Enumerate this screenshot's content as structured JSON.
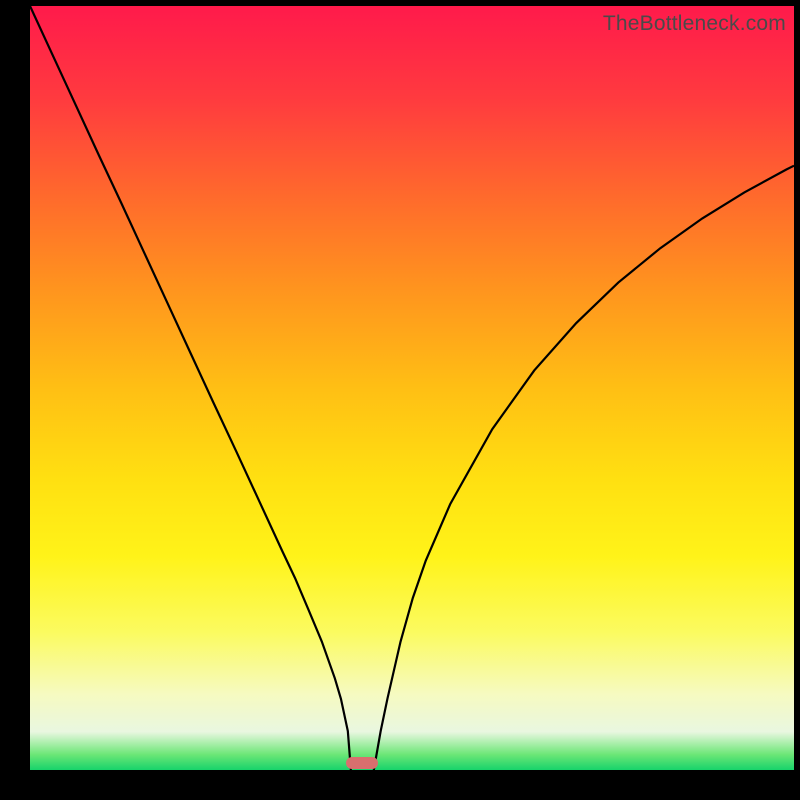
{
  "watermark": "TheBottleneck.com",
  "colors": {
    "curve": "#000000",
    "marker": "#d96f6e",
    "frame": "#000000"
  },
  "chart_data": {
    "type": "line",
    "title": "",
    "xlabel": "",
    "ylabel": "",
    "xlim": [
      0,
      100
    ],
    "ylim": [
      0,
      100
    ],
    "grid": false,
    "legend_position": "none",
    "annotations": [],
    "series": [
      {
        "name": "left",
        "x": [
          0,
          3,
          6,
          9,
          12,
          15,
          18,
          21,
          24,
          27,
          30,
          33,
          34.7,
          36.4,
          38.2,
          39.9,
          40.7,
          41.6,
          42.0
        ],
        "values": [
          100,
          93.5,
          87.0,
          80.5,
          74.1,
          67.6,
          61.1,
          54.6,
          48.1,
          41.7,
          35.2,
          28.7,
          25.1,
          21.1,
          16.8,
          12.0,
          9.3,
          5.1,
          0.0
        ]
      },
      {
        "name": "right",
        "x": [
          45.0,
          45.9,
          46.8,
          48.5,
          50.1,
          51.8,
          55.0,
          60.5,
          66.0,
          71.5,
          77.0,
          82.5,
          88.0,
          93.5,
          99.0,
          100.0
        ],
        "values": [
          0.0,
          5.1,
          9.4,
          16.8,
          22.5,
          27.4,
          34.8,
          44.6,
          52.3,
          58.5,
          63.8,
          68.3,
          72.2,
          75.6,
          78.6,
          79.1
        ]
      }
    ],
    "marker": {
      "x_center": 43.5,
      "y": 0.9,
      "width_x": 4.2,
      "height_y": 1.6
    }
  }
}
